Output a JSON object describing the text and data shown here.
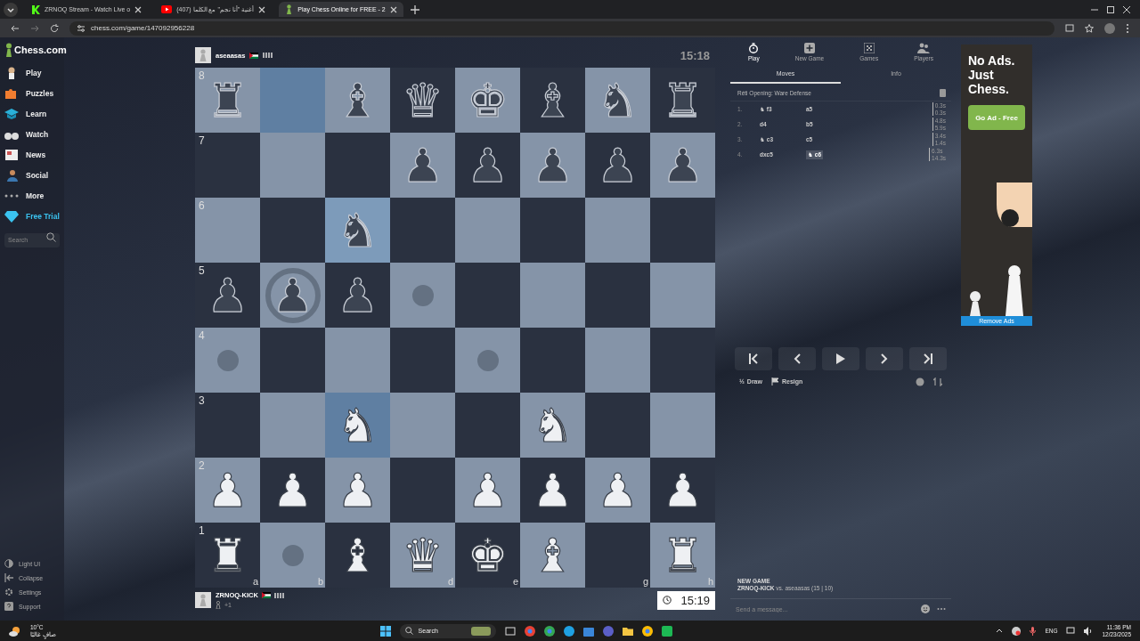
{
  "browser": {
    "tabs": [
      {
        "title": "ZRNOQ Stream - Watch Live o",
        "selected": false
      },
      {
        "title": "(407) أغنية \"أنا نجم\" مع الكلما",
        "selected": false
      },
      {
        "title": "Play Chess Online for FREE - 2 ",
        "selected": true
      }
    ],
    "url": "chess.com/game/147092956228"
  },
  "sidebar": {
    "logo": "Chess.com",
    "items": [
      {
        "label": "Play",
        "kind": "play"
      },
      {
        "label": "Puzzles",
        "kind": "puzzles"
      },
      {
        "label": "Learn",
        "kind": "learn"
      },
      {
        "label": "Watch",
        "kind": "watch"
      },
      {
        "label": "News",
        "kind": "news"
      },
      {
        "label": "Social",
        "kind": "social"
      },
      {
        "label": "More",
        "kind": "more"
      },
      {
        "label": "Free Trial",
        "kind": "trial"
      }
    ],
    "search": {
      "placeholder": "Search"
    },
    "footer": [
      {
        "label": "Light UI",
        "kind": "contrast"
      },
      {
        "label": "Collapse",
        "kind": "collapse"
      },
      {
        "label": "Settings",
        "kind": "settings"
      },
      {
        "label": "Support",
        "kind": "support"
      }
    ]
  },
  "top_player": {
    "name": "aseaasas",
    "clock": "15:18",
    "active": false
  },
  "bottom_player": {
    "name": "ZRNOQ-KICK",
    "material": "+1",
    "clock": "15:19",
    "active": true
  },
  "board": {
    "ranks": [
      {
        "label": "8",
        "squares": [
          {
            "piece": "♜",
            "white": false,
            "highlighted": false,
            "hint": false
          },
          {
            "highlighted": true,
            "hint": false
          },
          {
            "piece": "♝",
            "white": false,
            "highlighted": false,
            "hint": false
          },
          {
            "piece": "♛",
            "white": false,
            "highlighted": false,
            "hint": false
          },
          {
            "piece": "♚",
            "white": false,
            "highlighted": false,
            "hint": false
          },
          {
            "piece": "♝",
            "white": false,
            "highlighted": false,
            "hint": false
          },
          {
            "piece": "♞",
            "white": false,
            "highlighted": false,
            "hint": false
          },
          {
            "piece": "♜",
            "white": false,
            "highlighted": false,
            "hint": false
          }
        ]
      },
      {
        "label": "7",
        "squares": [
          {
            "highlighted": false,
            "hint": false
          },
          {
            "highlighted": false,
            "hint": false
          },
          {
            "highlighted": false,
            "hint": false
          },
          {
            "piece": "♟",
            "white": false,
            "highlighted": false,
            "hint": false
          },
          {
            "piece": "♟",
            "white": false,
            "highlighted": false,
            "hint": false
          },
          {
            "piece": "♟",
            "white": false,
            "highlighted": false,
            "hint": false
          },
          {
            "piece": "♟",
            "white": false,
            "highlighted": false,
            "hint": false
          },
          {
            "piece": "♟",
            "white": false,
            "highlighted": false,
            "hint": false
          }
        ]
      },
      {
        "label": "6",
        "squares": [
          {
            "highlighted": false,
            "hint": false
          },
          {
            "highlighted": false,
            "hint": false
          },
          {
            "piece": "♞",
            "white": false,
            "highlighted": true,
            "hint": false
          },
          {
            "highlighted": false,
            "hint": false
          },
          {
            "highlighted": false,
            "hint": false
          },
          {
            "highlighted": false,
            "hint": false
          },
          {
            "highlighted": false,
            "hint": false
          },
          {
            "highlighted": false,
            "hint": false
          }
        ]
      },
      {
        "label": "5",
        "squares": [
          {
            "piece": "♟",
            "white": false,
            "highlighted": false,
            "hint": false
          },
          {
            "piece": "♟",
            "white": false,
            "highlighted": false,
            "hint": true
          },
          {
            "piece": "♟",
            "white": false,
            "highlighted": false,
            "hint": false
          },
          {
            "highlighted": false,
            "hint": true
          },
          {
            "highlighted": false,
            "hint": false
          },
          {
            "highlighted": false,
            "hint": false
          },
          {
            "highlighted": false,
            "hint": false
          },
          {
            "highlighted": false,
            "hint": false
          }
        ]
      },
      {
        "label": "4",
        "squares": [
          {
            "highlighted": false,
            "hint": true
          },
          {
            "highlighted": false,
            "hint": false
          },
          {
            "highlighted": false,
            "hint": false
          },
          {
            "highlighted": false,
            "hint": false
          },
          {
            "highlighted": false,
            "hint": true
          },
          {
            "highlighted": false,
            "hint": false
          },
          {
            "highlighted": false,
            "hint": false
          },
          {
            "highlighted": false,
            "hint": false
          }
        ]
      },
      {
        "label": "3",
        "squares": [
          {
            "highlighted": false,
            "hint": false
          },
          {
            "highlighted": false,
            "hint": false
          },
          {
            "piece": "♞",
            "white": true,
            "highlighted": true,
            "hint": false
          },
          {
            "highlighted": false,
            "hint": false
          },
          {
            "highlighted": false,
            "hint": false
          },
          {
            "piece": "♞",
            "white": true,
            "highlighted": false,
            "hint": false
          },
          {
            "highlighted": false,
            "hint": false
          },
          {
            "highlighted": false,
            "hint": false
          }
        ]
      },
      {
        "label": "2",
        "squares": [
          {
            "piece": "♟",
            "white": true,
            "highlighted": false,
            "hint": false
          },
          {
            "piece": "♟",
            "white": true,
            "highlighted": false,
            "hint": false
          },
          {
            "piece": "♟",
            "white": true,
            "highlighted": false,
            "hint": false
          },
          {
            "highlighted": false,
            "hint": false
          },
          {
            "piece": "♟",
            "white": true,
            "highlighted": false,
            "hint": false
          },
          {
            "piece": "♟",
            "white": true,
            "highlighted": false,
            "hint": false
          },
          {
            "piece": "♟",
            "white": true,
            "highlighted": false,
            "hint": false
          },
          {
            "piece": "♟",
            "white": true,
            "highlighted": false,
            "hint": false
          }
        ]
      },
      {
        "label": "1",
        "squares": [
          {
            "piece": "♜",
            "white": true,
            "highlighted": false,
            "hint": false,
            "file": "a"
          },
          {
            "highlighted": false,
            "hint": true,
            "file": "b"
          },
          {
            "piece": "♝",
            "white": true,
            "highlighted": false,
            "hint": false
          },
          {
            "piece": "♛",
            "white": true,
            "highlighted": false,
            "hint": false,
            "file": "d"
          },
          {
            "piece": "♚",
            "white": true,
            "highlighted": false,
            "hint": false,
            "file": "e"
          },
          {
            "piece": "♝",
            "white": true,
            "highlighted": false,
            "hint": false
          },
          {
            "highlighted": false,
            "hint": false,
            "file": "g"
          },
          {
            "piece": "♜",
            "white": true,
            "highlighted": false,
            "hint": false,
            "file": "h"
          }
        ]
      }
    ]
  },
  "panel": {
    "nav": [
      {
        "label": "Play",
        "kind": "clock",
        "selected": true
      },
      {
        "label": "New Game",
        "kind": "plus",
        "selected": false
      },
      {
        "label": "Games",
        "kind": "grid",
        "selected": false
      },
      {
        "label": "Players",
        "kind": "people",
        "selected": false
      }
    ],
    "tabs": [
      {
        "label": "Moves",
        "selected": true
      },
      {
        "label": "Info",
        "selected": false
      }
    ],
    "opening": "Réti Opening: Ware Defense",
    "moves": [
      {
        "number": "1.",
        "white": {
          "piece": "♞",
          "san": "f3",
          "selected": false
        },
        "black": {
          "san": "a5",
          "selected": false
        },
        "white_time": "0.3s",
        "black_time": "0.3s"
      },
      {
        "number": "2.",
        "white": {
          "san": "d4",
          "selected": false
        },
        "black": {
          "san": "b5",
          "selected": false
        },
        "white_time": "4.8s",
        "black_time": "5.9s"
      },
      {
        "number": "3.",
        "white": {
          "piece": "♞",
          "san": "c3",
          "selected": false
        },
        "black": {
          "san": "c5",
          "selected": false
        },
        "white_time": "3.4s",
        "black_time": "1.4s"
      },
      {
        "number": "4.",
        "white": {
          "san": "dxc5",
          "selected": false
        },
        "black": {
          "piece": "♞",
          "san": "c6",
          "selected": true
        },
        "white_time": "6.3s",
        "black_time": "14.3s"
      }
    ],
    "draw": {
      "glyph": "½",
      "label": "Draw"
    },
    "resign": "Resign",
    "game_title": "NEW GAME",
    "game_white": "ZRNOQ-KICK",
    "game_rest": "vs. aseaasas (15 | 10)",
    "chat": {
      "placeholder": "Send a message..."
    }
  },
  "ad": {
    "headline": "No Ads. Just Chess.",
    "button": "Go Ad - Free",
    "footer": "Remove Ads"
  },
  "taskbar": {
    "weather_temp": "10°C",
    "weather_text": "صافٍ غالبًا",
    "search": "Search",
    "language": "ENG",
    "time": "11:36 PM",
    "date": "12/23/2025"
  }
}
